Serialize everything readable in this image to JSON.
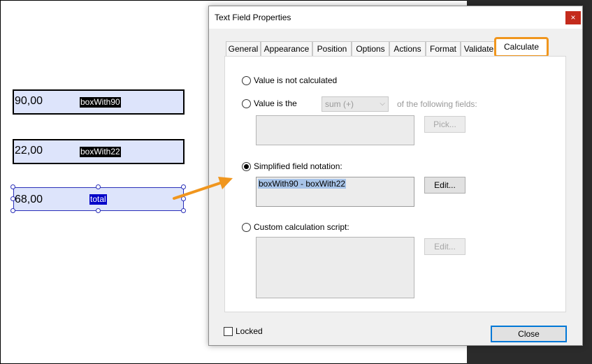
{
  "pdf_fields": [
    {
      "value": "90,00",
      "name": "boxWith90"
    },
    {
      "value": "22,00",
      "name": "boxWith22"
    },
    {
      "value": "68,00",
      "name": "total"
    }
  ],
  "dialog": {
    "title": "Text Field Properties",
    "close_glyph": "×",
    "tabs": [
      "General",
      "Appearance",
      "Position",
      "Options",
      "Actions",
      "Format",
      "Validate",
      "Calculate"
    ],
    "active_tab": "Calculate",
    "options": {
      "not_calculated": "Value is not calculated",
      "value_is_the": "Value is the",
      "function_select": "sum (+)",
      "of_following_fields": "of the following fields:",
      "pick_button": "Pick...",
      "simplified_notation": "Simplified field notation:",
      "notation_value": "boxWith90 - boxWith22",
      "edit_button": "Edit...",
      "custom_script": "Custom calculation script:",
      "edit_button_disabled": "Edit..."
    },
    "locked_label": "Locked",
    "close_button": "Close"
  },
  "colors": {
    "highlight_border": "#f0961e",
    "arrow": "#f0961e",
    "field_fill": "#dde4fb",
    "selection": "#2a2fb8"
  }
}
